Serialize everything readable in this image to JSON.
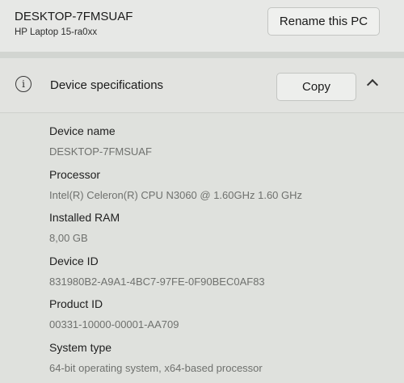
{
  "header": {
    "pc_name": "DESKTOP-7FMSUAF",
    "pc_model": "HP Laptop 15-ra0xx",
    "rename_label": "Rename this PC"
  },
  "device_specs": {
    "title": "Device specifications",
    "copy_label": "Copy",
    "info_icon": "info-icon",
    "collapse_icon": "chevron-up-icon",
    "items": [
      {
        "label": "Device name",
        "value": "DESKTOP-7FMSUAF"
      },
      {
        "label": "Processor",
        "value": "Intel(R) Celeron(R) CPU  N3060  @ 1.60GHz   1.60 GHz"
      },
      {
        "label": "Installed RAM",
        "value": "8,00 GB"
      },
      {
        "label": "Device ID",
        "value": "831980B2-A9A1-4BC7-97FE-0F90BEC0AF83"
      },
      {
        "label": "Product ID",
        "value": "00331-10000-00001-AA709"
      },
      {
        "label": "System type",
        "value": "64-bit operating system, x64-based processor"
      }
    ]
  }
}
